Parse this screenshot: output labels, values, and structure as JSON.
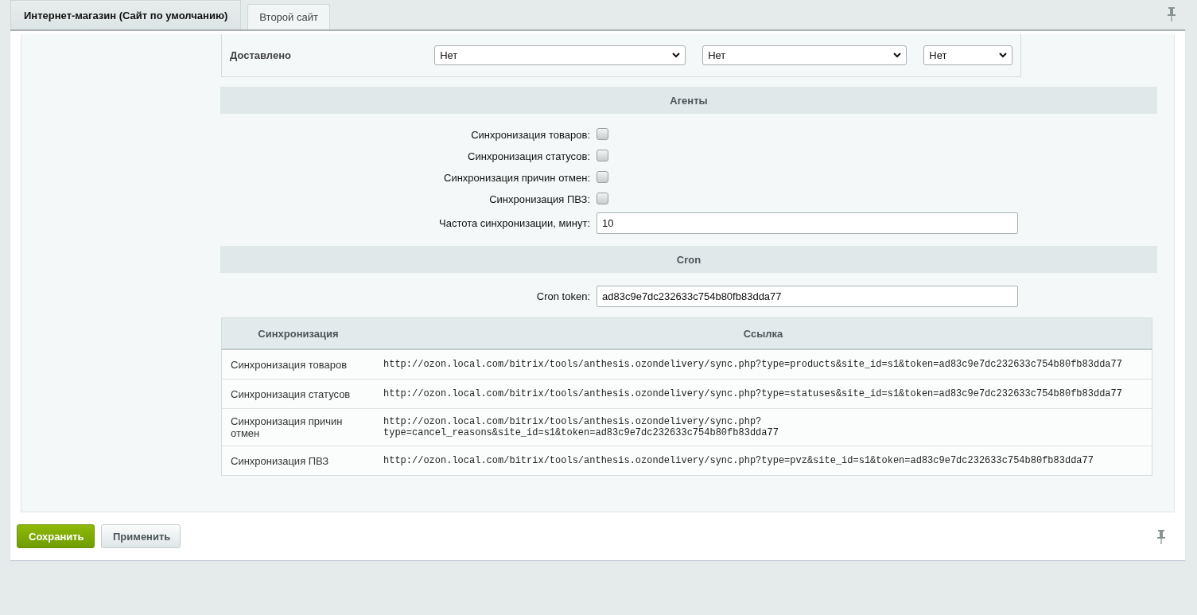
{
  "tabs": [
    {
      "label": "Интернет-магазин (Сайт по умолчанию)",
      "selected": true
    },
    {
      "label": "Второй сайт",
      "selected": false
    }
  ],
  "status_row": {
    "label": "Доставлено",
    "selects": [
      {
        "value": "Нет"
      },
      {
        "value": "Нет"
      },
      {
        "value": "Нет"
      }
    ]
  },
  "sections": [
    {
      "title": "Агенты",
      "rows": [
        {
          "kind": "checkbox",
          "label": "Синхронизация товаров:",
          "checked": false
        },
        {
          "kind": "checkbox",
          "label": "Синхронизация статусов:",
          "checked": false
        },
        {
          "kind": "checkbox",
          "label": "Синхронизация причин отмен:",
          "checked": false
        },
        {
          "kind": "checkbox",
          "label": "Синхронизация ПВЗ:",
          "checked": false
        },
        {
          "kind": "field",
          "label": "Частота синхронизации, минут:",
          "value": "10"
        }
      ]
    },
    {
      "title": "Cron",
      "rows": [
        {
          "kind": "field",
          "label": "Cron token:",
          "value": "ad83c9e7dc232633c754b80fb83dda77"
        }
      ],
      "table": {
        "columns": [
          "Синхронизация",
          "Ссылка"
        ],
        "rows": [
          {
            "name": "Синхронизация товаров",
            "url": "http://ozon.local.com/bitrix/tools/anthesis.ozondelivery/sync.php?type=products&site_id=s1&token=ad83c9e7dc232633c754b80fb83dda77"
          },
          {
            "name": "Синхронизация статусов",
            "url": "http://ozon.local.com/bitrix/tools/anthesis.ozondelivery/sync.php?type=statuses&site_id=s1&token=ad83c9e7dc232633c754b80fb83dda77"
          },
          {
            "name": "Синхронизация причин отмен",
            "url": "http://ozon.local.com/bitrix/tools/anthesis.ozondelivery/sync.php?type=cancel_reasons&site_id=s1&token=ad83c9e7dc232633c754b80fb83dda77"
          },
          {
            "name": "Синхронизация ПВЗ",
            "url": "http://ozon.local.com/bitrix/tools/anthesis.ozondelivery/sync.php?type=pvz&site_id=s1&token=ad83c9e7dc232633c754b80fb83dda77"
          }
        ]
      }
    }
  ],
  "buttons": [
    {
      "label": "Сохранить",
      "kind": "primary"
    },
    {
      "label": "Применить",
      "kind": "secondary"
    }
  ]
}
